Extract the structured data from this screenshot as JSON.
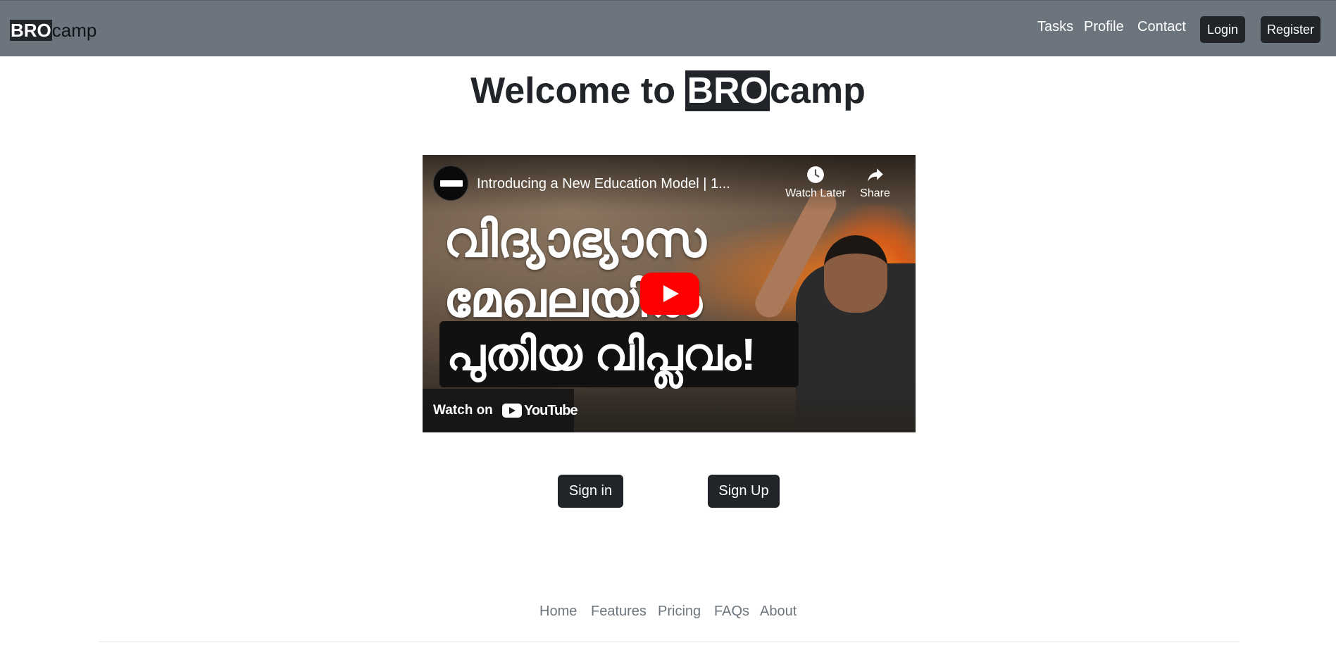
{
  "navbar": {
    "brand": {
      "highlight": "BRO",
      "rest": "camp"
    },
    "links": [
      "Tasks",
      "Profile",
      "Contact"
    ],
    "login_label": "Login",
    "register_label": "Register"
  },
  "main": {
    "heading": {
      "prefix": "Welcome to ",
      "highlight": "BRO",
      "rest": "camp"
    },
    "video": {
      "title": "Introducing a New Education Model | 1...",
      "watch_later_label": "Watch Later",
      "share_label": "Share",
      "thumbnail_lines": [
        "വിദ്യാഭ്യാസ",
        "മേഖലയിൽ",
        "പുതിയ വിപ്ലവം!"
      ],
      "watch_on_label": "Watch on",
      "youtube_label": "YouTube"
    },
    "signin_label": "Sign in",
    "signup_label": "Sign Up"
  },
  "footer": {
    "links": [
      "Home",
      "Features",
      "Pricing",
      "FAQs",
      "About"
    ]
  },
  "colors": {
    "navbar_bg": "#6c757d",
    "dark_button": "#212529",
    "footer_text": "#6c757d",
    "play_red": "#ff0000"
  },
  "icons": [
    "clock-icon",
    "share-arrow-icon",
    "play-icon",
    "youtube-logo-icon"
  ]
}
